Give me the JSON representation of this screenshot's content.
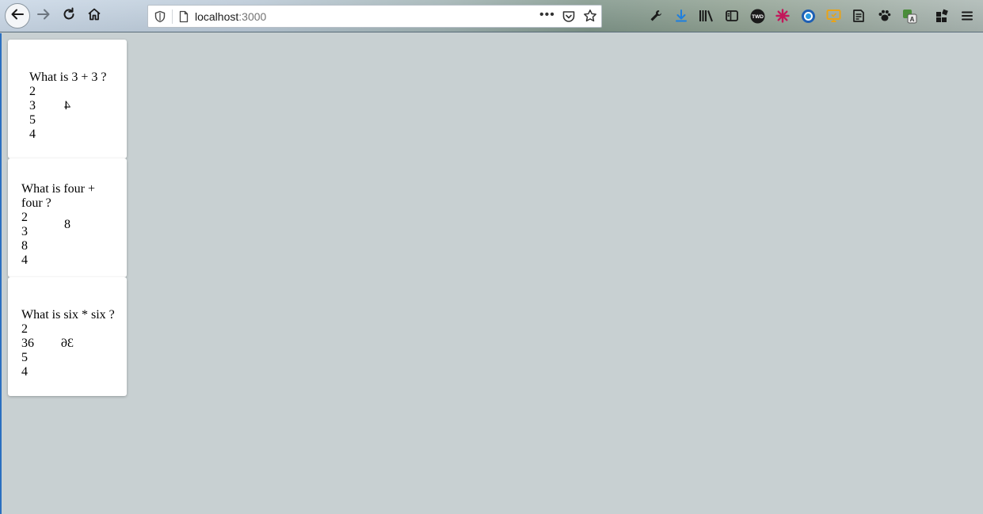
{
  "browser": {
    "url_host": "localhost",
    "url_port": ":3000",
    "more_label": "•••"
  },
  "cards": [
    {
      "question": "What is 3 + 3 ?",
      "choices": [
        "2",
        "3",
        "5",
        "4"
      ],
      "answer": "4"
    },
    {
      "question": "What is four + four ?",
      "choices": [
        "2",
        "3",
        "8",
        "4"
      ],
      "answer": "8"
    },
    {
      "question": "What is six * six ?",
      "choices": [
        "2",
        "36",
        "5",
        "4"
      ],
      "answer": "36"
    }
  ],
  "icons": {
    "back": "arrow-left-icon",
    "forward": "arrow-right-icon",
    "reload": "reload-icon",
    "home": "home-icon",
    "shield": "tracking-shield-icon",
    "page": "page-icon",
    "pocket": "pocket-icon",
    "bookmark": "star-icon",
    "extensions": [
      "wrench-icon",
      "download-icon",
      "library-icon",
      "sidebar-icon",
      "twd-icon",
      "puzzle-icon",
      "globe-icon",
      "monitor-icon",
      "notes-icon",
      "paw-icon",
      "translate-icon",
      "apps-icon",
      "menu-icon"
    ]
  },
  "colors": {
    "page_background": "#c8d0d2",
    "card_background": "#ffffff",
    "download_accent": "#1d7fe0"
  }
}
